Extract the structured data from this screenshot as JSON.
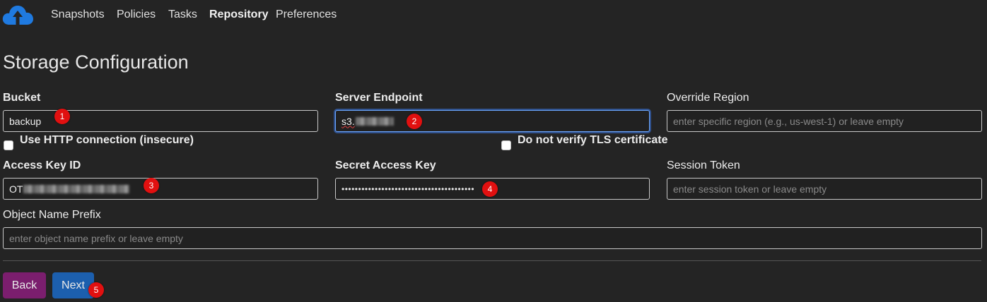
{
  "nav": {
    "logo_icon": "cloud-upload-icon",
    "items": [
      "Snapshots",
      "Policies",
      "Tasks",
      "Repository",
      "Preferences"
    ],
    "active": "Repository"
  },
  "page_title": "Storage Configuration",
  "fields": {
    "bucket": {
      "label": "Bucket",
      "value": "backup"
    },
    "server_endpoint": {
      "label": "Server Endpoint",
      "value": "s3."
    },
    "override_region": {
      "label": "Override Region",
      "placeholder": "enter specific region (e.g., us-west-1) or leave empty"
    },
    "access_key_id": {
      "label": "Access Key ID",
      "value": "OT"
    },
    "secret_access_key": {
      "label": "Secret Access Key",
      "value": "••••••••••••••••••••••••••••••••••••••••"
    },
    "session_token": {
      "label": "Session Token",
      "placeholder": "enter session token or leave empty"
    },
    "object_name_prefix": {
      "label": "Object Name Prefix",
      "placeholder": "enter object name prefix or leave empty"
    }
  },
  "checkboxes": {
    "http": {
      "label": "Use HTTP connection (insecure)",
      "checked": false
    },
    "tls": {
      "label": "Do not verify TLS certificate",
      "checked": false
    }
  },
  "buttons": {
    "back": "Back",
    "next": "Next"
  },
  "markers": [
    "1",
    "2",
    "3",
    "4",
    "5"
  ],
  "colors": {
    "background": "#242424",
    "back_button": "#7b1e6e",
    "next_button": "#1c5fae",
    "focus_ring": "#6ea8fe",
    "marker": "#e11010",
    "logo": "#1f7ae0"
  }
}
